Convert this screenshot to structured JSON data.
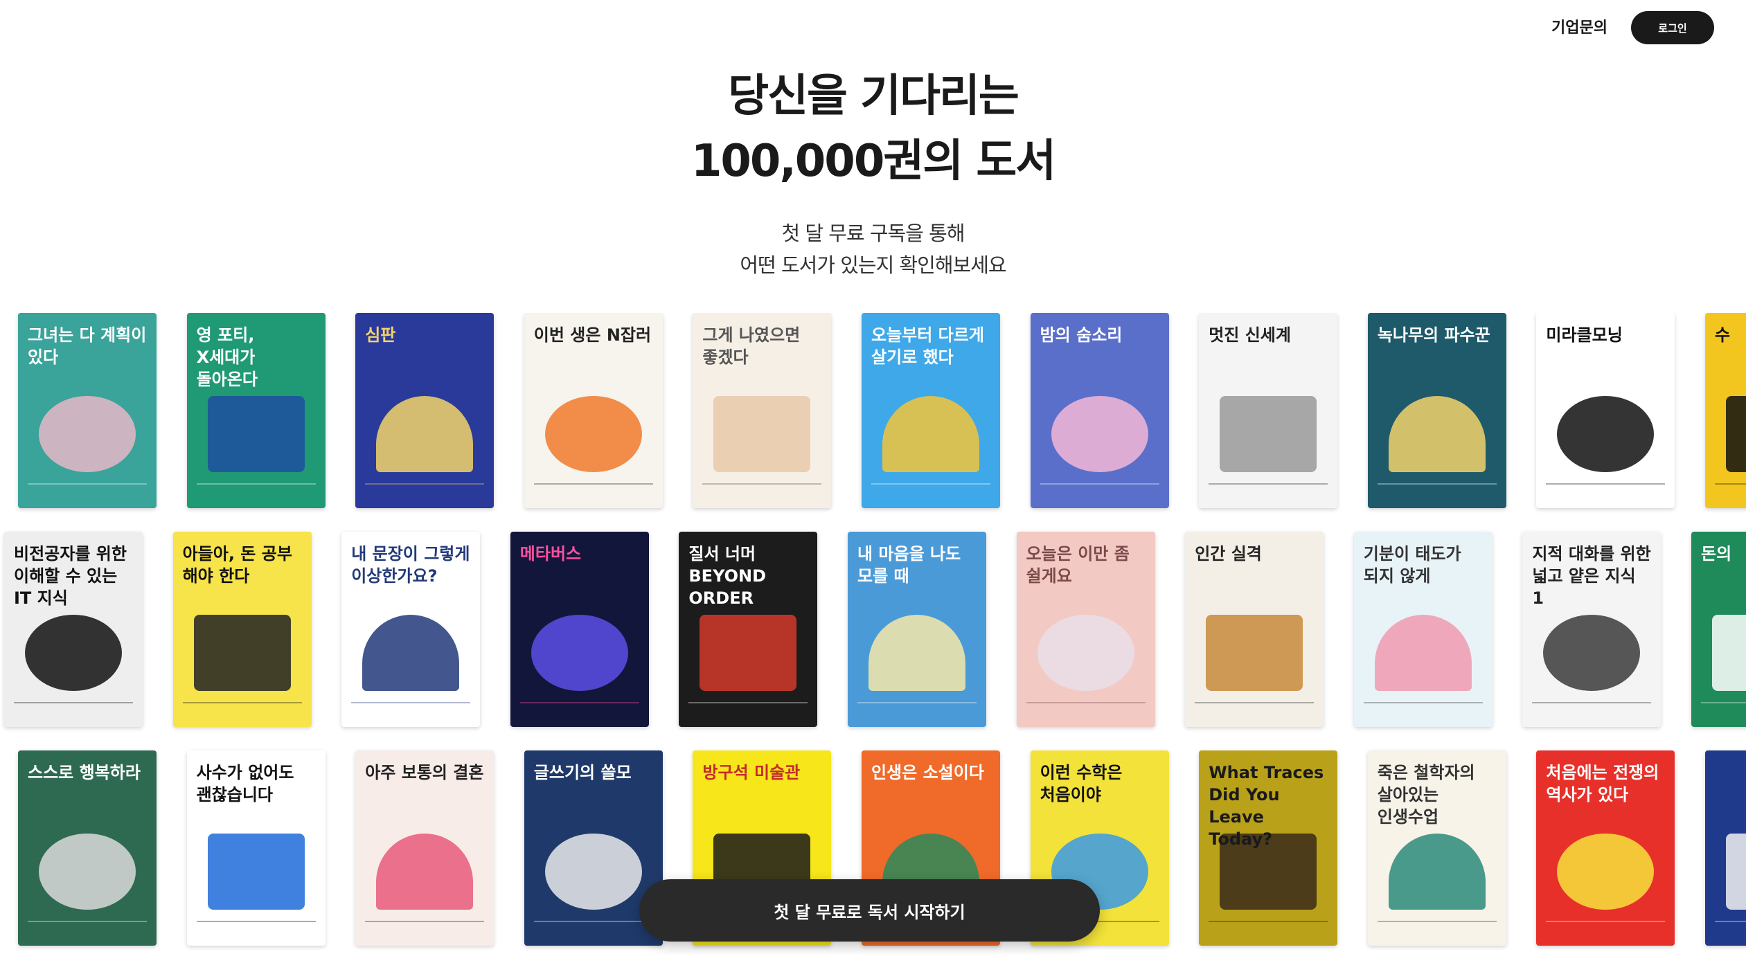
{
  "header": {
    "business_link": "기업문의",
    "login_button": "로그인"
  },
  "hero": {
    "title_line1": "당신을 기다리는",
    "title_line2": "100,000권의 도서",
    "subtitle_line1": "첫 달 무료 구독을 통해",
    "subtitle_line2": "어떤 도서가 있는지 확인해보세요"
  },
  "cta": {
    "label": "첫 달 무료로 독서 시작하기"
  },
  "book_rows": [
    [
      {
        "title": "그녀는 다 계획이 있다",
        "bg": "#3aa39a",
        "fg": "#ffffff",
        "accent": "#e8b7c8"
      },
      {
        "title": "영 포티, X세대가 돌아온다",
        "bg": "#1f9a74",
        "fg": "#ffffff",
        "accent": "#1e4fa0"
      },
      {
        "title": "심판",
        "bg": "#2a3a9a",
        "fg": "#f2d46a",
        "accent": "#f2d46a"
      },
      {
        "title": "이번 생은 N잡러",
        "bg": "#f7f4ee",
        "fg": "#222222",
        "accent": "#f07a2c"
      },
      {
        "title": "그게 나였으면 좋겠다",
        "bg": "#f6efe6",
        "fg": "#555555",
        "accent": "#e8c9a9"
      },
      {
        "title": "오늘부터 다르게 살기로 했다",
        "bg": "#3fa8e8",
        "fg": "#ffffff",
        "accent": "#f2c53a"
      },
      {
        "title": "밤의 숨소리",
        "bg": "#5a6fc9",
        "fg": "#ffffff",
        "accent": "#f3b7d6"
      },
      {
        "title": "멋진 신세계",
        "bg": "#f4f4f4",
        "fg": "#222222",
        "accent": "#999999"
      },
      {
        "title": "녹나무의 파수꾼",
        "bg": "#1e5a6a",
        "fg": "#ffffff",
        "accent": "#f2d46a"
      },
      {
        "title": "미라클모닝",
        "bg": "#ffffff",
        "fg": "#111111",
        "accent": "#111111"
      },
      {
        "title": "수",
        "bg": "#f2c61f",
        "fg": "#111111",
        "accent": "#111111"
      }
    ],
    [
      {
        "title": "비전공자를 위한 이해할 수 있는 IT 지식",
        "bg": "#eeeeee",
        "fg": "#111111",
        "accent": "#111111"
      },
      {
        "title": "아들아, 돈 공부 해야 한다",
        "bg": "#f7e34a",
        "fg": "#111111",
        "accent": "#222222"
      },
      {
        "title": "내 문장이 그렇게 이상한가요?",
        "bg": "#ffffff",
        "fg": "#223a7a",
        "accent": "#223a7a"
      },
      {
        "title": "메타버스",
        "bg": "#11163a",
        "fg": "#ff4fa0",
        "accent": "#5a4fe8"
      },
      {
        "title": "질서 너머 BEYOND ORDER",
        "bg": "#1c1c1c",
        "fg": "#ffffff",
        "accent": "#d23a2a"
      },
      {
        "title": "내 마음을 나도 모를 때",
        "bg": "#4a9ad8",
        "fg": "#ffffff",
        "accent": "#f5e7a9"
      },
      {
        "title": "오늘은 이만 좀 쉴게요",
        "bg": "#f3c9c4",
        "fg": "#7a4a4a",
        "accent": "#e8dfe8"
      },
      {
        "title": "인간 실격",
        "bg": "#f4efe6",
        "fg": "#222222",
        "accent": "#c58a3a"
      },
      {
        "title": "기분이 태도가 되지 않게",
        "bg": "#e8f3f8",
        "fg": "#333333",
        "accent": "#f09ab0"
      },
      {
        "title": "지적 대화를 위한 넓고 얕은 지식 1",
        "bg": "#f4f4f4",
        "fg": "#222222",
        "accent": "#3a3a3a"
      },
      {
        "title": "돈의",
        "bg": "#1f8a5a",
        "fg": "#ffffff",
        "accent": "#ffffff"
      }
    ],
    [
      {
        "title": "스스로 행복하라",
        "bg": "#2e6a52",
        "fg": "#ffffff",
        "accent": "#d9d9d9"
      },
      {
        "title": "사수가 없어도 괜찮습니다",
        "bg": "#ffffff",
        "fg": "#111111",
        "accent": "#1f6ad8"
      },
      {
        "title": "아주 보통의 결혼",
        "bg": "#f7ece8",
        "fg": "#222222",
        "accent": "#e85a7a"
      },
      {
        "title": "글쓰기의 쓸모",
        "bg": "#1f3a6a",
        "fg": "#ffffff",
        "accent": "#eaeaea"
      },
      {
        "title": "방구석 미술관",
        "bg": "#f6e61a",
        "fg": "#c42a2a",
        "accent": "#1a1a1a"
      },
      {
        "title": "인생은 소설이다",
        "bg": "#f06a2a",
        "fg": "#ffffff",
        "accent": "#2a8a5a"
      },
      {
        "title": "이런 수학은 처음이야",
        "bg": "#f2e23a",
        "fg": "#111111",
        "accent": "#3a9ae8"
      },
      {
        "title": "What Traces Did You Leave Today?",
        "bg": "#b9a21a",
        "fg": "#1a1a1a",
        "accent": "#3a2a1a"
      },
      {
        "title": "죽은 철학자의 살아있는 인생수업",
        "bg": "#f7f3e8",
        "fg": "#333333",
        "accent": "#2a8a7a"
      },
      {
        "title": "처음에는 전쟁의 역사가 있다",
        "bg": "#e8302a",
        "fg": "#ffffff",
        "accent": "#f4e23a"
      },
      {
        "title": "",
        "bg": "#1f3a8a",
        "fg": "#ffffff",
        "accent": "#f2f2f2"
      }
    ]
  ]
}
